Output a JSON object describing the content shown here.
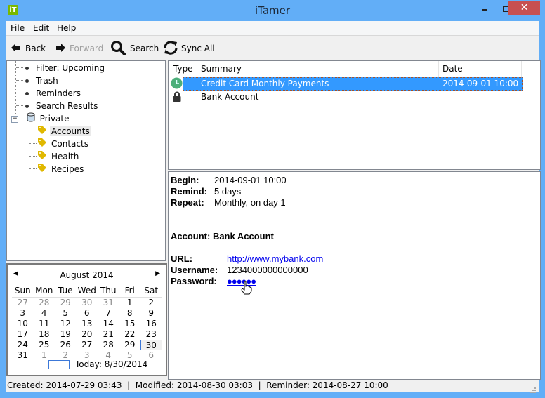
{
  "window": {
    "title": "iTamer",
    "app_icon_text": "iT",
    "close_glyph": "✕"
  },
  "menu": [
    {
      "label": "File",
      "accel": "F",
      "rest": "ile"
    },
    {
      "label": "Edit",
      "accel": "E",
      "rest": "dit"
    },
    {
      "label": "Help",
      "accel": "H",
      "rest": "elp"
    }
  ],
  "toolbar": {
    "back": "Back",
    "forward": "Forward",
    "search": "Search",
    "sync": "Sync All"
  },
  "tree": {
    "items": [
      {
        "label": "Filter: Upcoming",
        "icon": "bullet-icon"
      },
      {
        "label": "Trash",
        "icon": "bullet-icon"
      },
      {
        "label": "Reminders",
        "icon": "bullet-icon"
      },
      {
        "label": "Search Results",
        "icon": "bullet-icon"
      },
      {
        "label": "Private",
        "icon": "database-icon",
        "expanded": true
      },
      {
        "label": "Accounts",
        "icon": "tag-icon",
        "selected": true
      },
      {
        "label": "Contacts",
        "icon": "tag-icon"
      },
      {
        "label": "Health",
        "icon": "tag-icon"
      },
      {
        "label": "Recipes",
        "icon": "tag-icon"
      }
    ]
  },
  "calendar": {
    "month_label": "August 2014",
    "days_of_week": [
      "Sun",
      "Mon",
      "Tue",
      "Wed",
      "Thu",
      "Fri",
      "Sat"
    ],
    "weeks": [
      [
        "27",
        "28",
        "29",
        "30",
        "31",
        "1",
        "2"
      ],
      [
        "3",
        "4",
        "5",
        "6",
        "7",
        "8",
        "9"
      ],
      [
        "10",
        "11",
        "12",
        "13",
        "14",
        "15",
        "16"
      ],
      [
        "17",
        "18",
        "19",
        "20",
        "21",
        "22",
        "23"
      ],
      [
        "24",
        "25",
        "26",
        "27",
        "28",
        "29",
        "30"
      ],
      [
        "31",
        "1",
        "2",
        "3",
        "4",
        "5",
        "6"
      ]
    ],
    "selected_day": "30",
    "today_label": "Today: 8/30/2014"
  },
  "list": {
    "columns": [
      "Type",
      "Summary",
      "Date"
    ],
    "rows": [
      {
        "type_icon": "clock-icon",
        "summary": "Credit Card Monthly Payments",
        "date": "2014-09-01 10:00",
        "selected": true
      },
      {
        "type_icon": "lock-icon",
        "summary": "Bank Account",
        "date": ""
      }
    ]
  },
  "detail": {
    "begin_label": "Begin:",
    "begin_value": "2014-09-01 10:00",
    "remind_label": "Remind:",
    "remind_value": "5 days",
    "repeat_label": "Repeat:",
    "repeat_value": "Monthly, on day 1",
    "account_heading": "Account: Bank Account",
    "url_label": "URL:",
    "url_value": "http://www.mybank.com",
    "username_label": "Username:",
    "username_value": "1234000000000000",
    "password_label": "Password:",
    "password_value": "●●●●●●"
  },
  "status": {
    "text": "Created: 2014-07-29 03:43  |  Modified: 2014-08-30 03:03  |  Reminder: 2014-08-27 10:00"
  },
  "colors": {
    "titlebar": "#62aef7",
    "selection": "#3399ff",
    "close_button": "#c75050",
    "link": "#0000ee",
    "tag": "#e0b800",
    "clock": "#4caf7a"
  }
}
